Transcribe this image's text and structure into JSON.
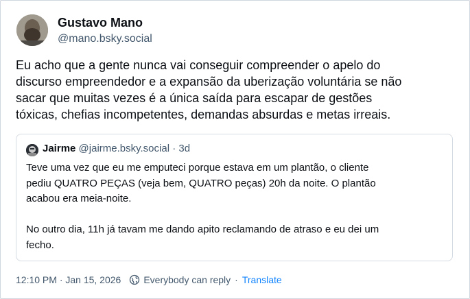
{
  "post": {
    "author": {
      "display_name": "Gustavo Mano",
      "handle": "@mano.bsky.social"
    },
    "text": "Eu acho que a gente nunca vai conseguir compreender o apelo do\ndiscurso empreendedor e a expansão da uberização voluntária se não\nsacar que muitas vezes é a única saída para escapar de gestões\ntóxicas, chefias incompetentes, demandas absurdas e metas irreais.",
    "quote": {
      "author_name": "Jairme",
      "author_handle": "@jairme.bsky.social",
      "separator": "·",
      "age": "3d",
      "text": "Teve uma vez que eu me emputeci porque estava em um plantão, o cliente\npediu QUATRO PEÇAS (veja bem, QUATRO peças) 20h da noite. O plantão\nacabou era meia-noite.\n\nNo outro dia, 11h já tavam me dando apito reclamando de atraso e eu dei um\nfecho."
    },
    "footer": {
      "timestamp": "12:10 PM · Jan 15, 2026",
      "reply_setting": "Everybody can reply",
      "separator": "·",
      "translate_label": "Translate"
    }
  },
  "icons": {
    "reply_setting": "globe-icon"
  },
  "colors": {
    "text_primary": "#0b0f14",
    "text_secondary": "#42576c",
    "link": "#1083fe",
    "border": "#d4dbe2"
  }
}
